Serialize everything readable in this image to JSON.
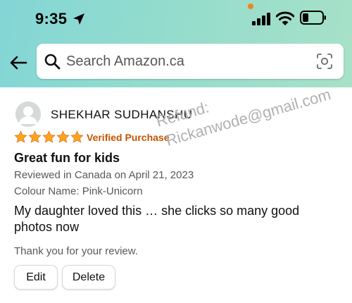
{
  "status_bar": {
    "time": "9:35"
  },
  "search": {
    "placeholder": "Search Amazon.ca"
  },
  "review": {
    "reviewer_name": "SHEKHAR SUDHANSHU",
    "rating": 5,
    "rating_max": 5,
    "verified_label": "Verified Purchase",
    "title": "Great fun for kids",
    "date_line": "Reviewed in Canada on April 21, 2023",
    "variant_line": "Colour Name: Pink-Unicorn",
    "body": "My daughter loved this … she clicks so many good photos now",
    "thanks_message": "Thank you for your review."
  },
  "actions": {
    "edit_label": "Edit",
    "delete_label": "Delete"
  },
  "watermark": {
    "line1": "Refund:",
    "line2": "Rickanwode@gmail.com"
  },
  "colors": {
    "header_gradient_start": "#83d6d6",
    "header_gradient_end": "#a7e1c8",
    "star": "#ffa41c",
    "verified": "#c45500",
    "secondary_text": "#565959",
    "watermark_text": "#b0b0b0"
  },
  "icons": {
    "back": "back-arrow-icon",
    "search": "search-icon",
    "camera": "camera-scan-icon",
    "location": "location-arrow-icon",
    "signal": "cellular-signal-icon",
    "wifi": "wifi-icon",
    "battery": "battery-icon",
    "avatar": "user-avatar-icon",
    "star": "star-icon"
  }
}
